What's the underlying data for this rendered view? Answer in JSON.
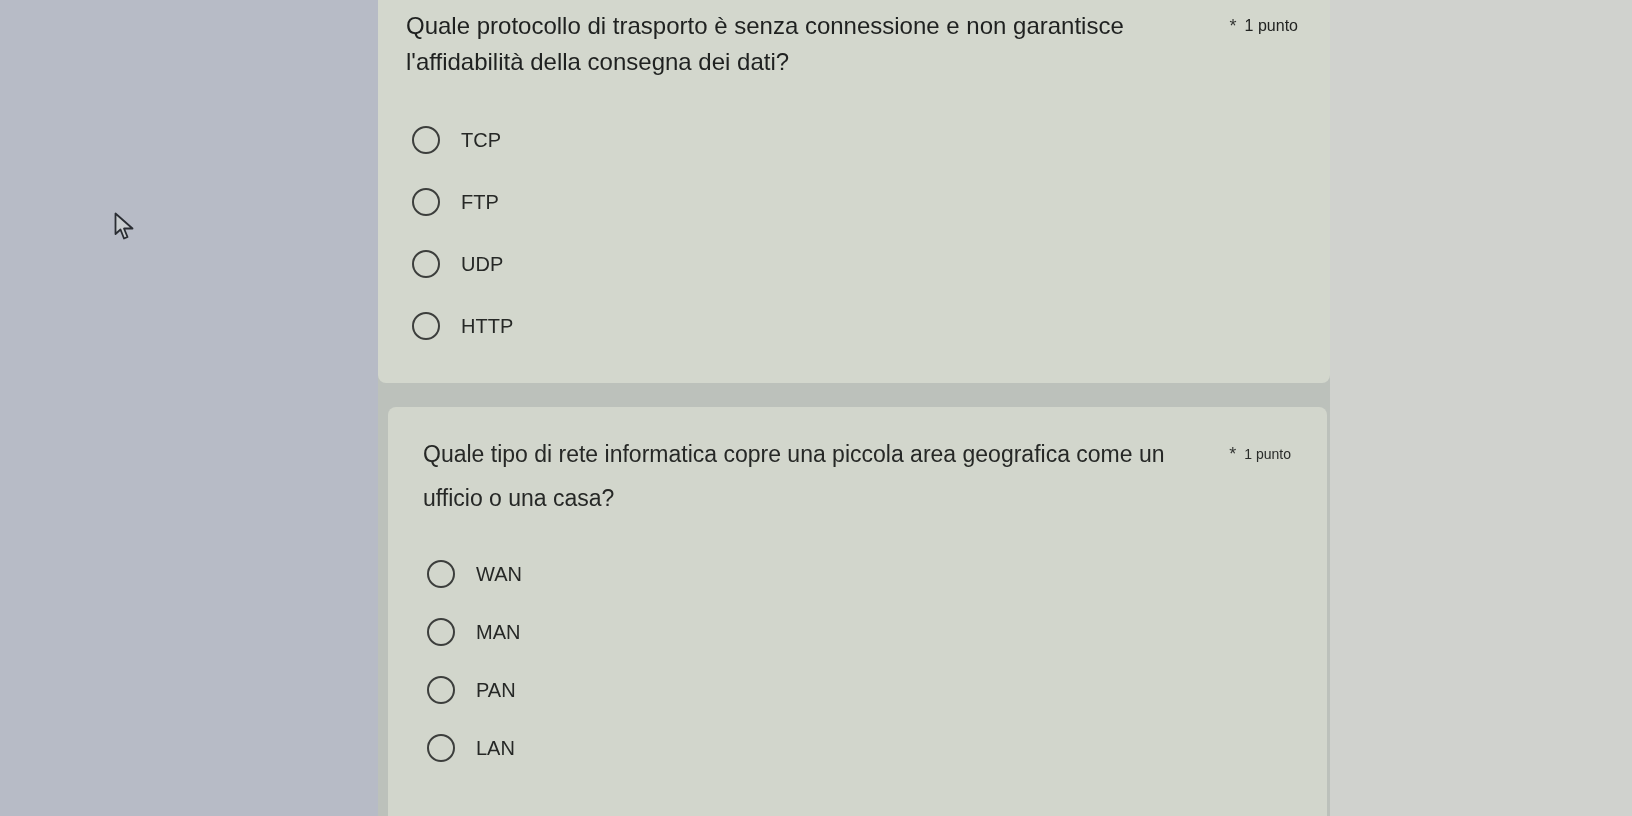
{
  "questions": [
    {
      "text": "Quale protocollo di trasporto è senza connessione e non garantisce l'affidabilità della consegna dei dati?",
      "required_mark": "*",
      "points": "1 punto",
      "options": [
        {
          "label": "TCP",
          "selected": false
        },
        {
          "label": "FTP",
          "selected": false
        },
        {
          "label": "UDP",
          "selected": false
        },
        {
          "label": "HTTP",
          "selected": false
        }
      ]
    },
    {
      "text": "Quale tipo di rete informatica copre una piccola area geografica come un ufficio o una casa?",
      "required_mark": "*",
      "points": "1 punto",
      "options": [
        {
          "label": "WAN",
          "selected": false
        },
        {
          "label": "MAN",
          "selected": false
        },
        {
          "label": "PAN",
          "selected": false
        },
        {
          "label": "LAN",
          "selected": false
        }
      ]
    }
  ]
}
